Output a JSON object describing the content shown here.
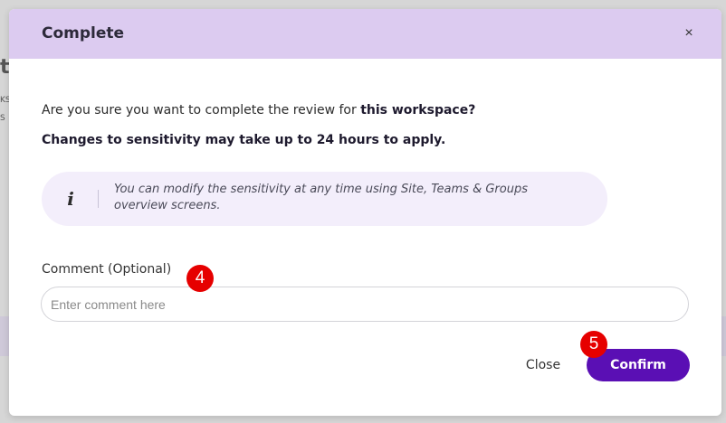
{
  "background": {
    "glyph_large": "ty",
    "glyph_small_1": "KS",
    "glyph_small_2": "S"
  },
  "modal": {
    "title": "Complete",
    "close_icon": "×",
    "question_prefix": "Are you sure you want to complete the review for ",
    "question_bold": "this workspace?",
    "warning": "Changes to sensitivity may take up to 24 hours to apply.",
    "info": {
      "icon": "i",
      "text": "You can modify the sensitivity at any time using Site, Teams & Groups overview screens."
    },
    "comment": {
      "label": "Comment (Optional)",
      "placeholder": "Enter comment here",
      "value": ""
    },
    "buttons": {
      "close_label": "Close",
      "confirm_label": "Confirm"
    }
  },
  "annotations": {
    "step_4": "4",
    "step_5": "5"
  },
  "colors": {
    "header_bg": "#dccbf0",
    "info_bg": "#f3eefb",
    "confirm_bg": "#5a0fb4",
    "badge_red": "#e60000"
  }
}
